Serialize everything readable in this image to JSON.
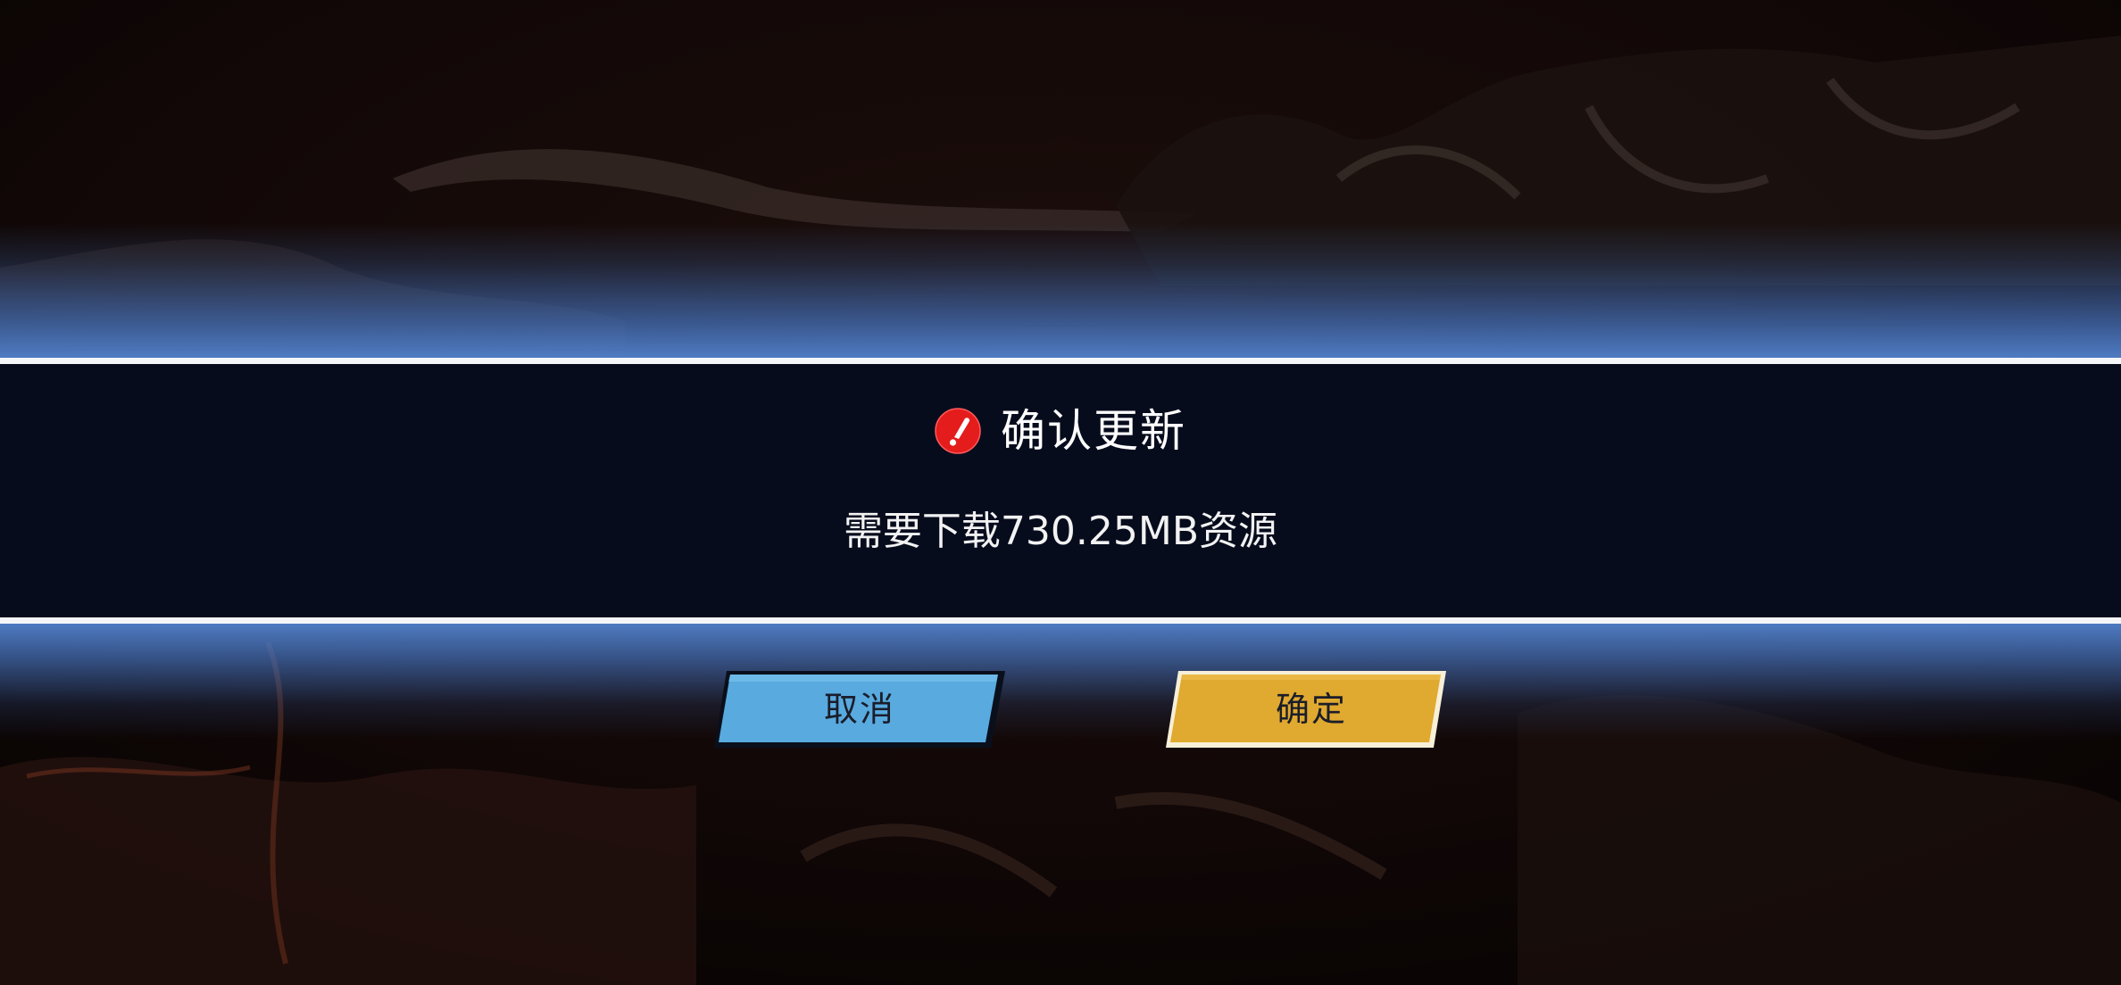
{
  "dialog": {
    "title": "确认更新",
    "message": "需要下载730.25MB资源",
    "icon": "alert-icon"
  },
  "buttons": {
    "cancel_label": "取消",
    "confirm_label": "确定"
  },
  "colors": {
    "band_background": "#070c1d",
    "band_border": "#f4f6f8",
    "glow_blue": "#4f80cd",
    "cancel_button": "#58aadf",
    "confirm_button": "#e0a92f",
    "alert_red": "#e41c1c"
  }
}
